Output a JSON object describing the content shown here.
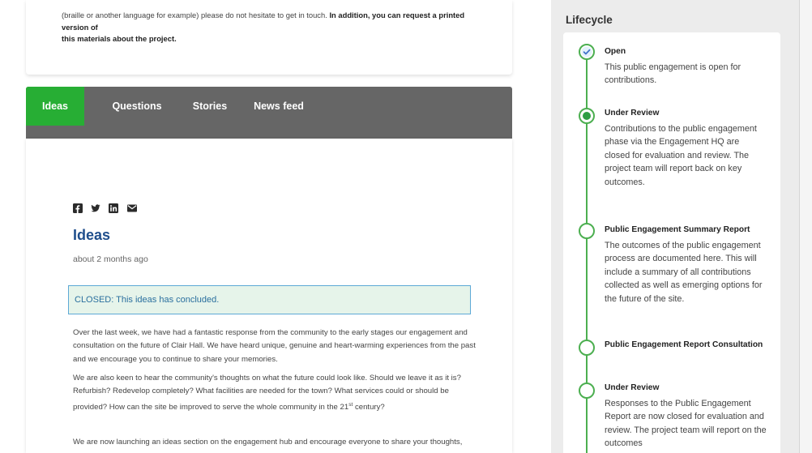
{
  "intro": {
    "line1_regular": "(braille or another language for example) please do not hesitate to get in touch.",
    "line1_bold": "In addition, you can request a printed version of",
    "line2_bold": "this materials about the project."
  },
  "tabs": [
    {
      "label": "Ideas",
      "active": true
    },
    {
      "label": "Questions",
      "active": false
    },
    {
      "label": "Stories",
      "active": false
    },
    {
      "label": "News feed",
      "active": false
    }
  ],
  "share": [
    {
      "icon": "facebook-icon"
    },
    {
      "icon": "twitter-icon"
    },
    {
      "icon": "linkedin-icon"
    },
    {
      "icon": "email-icon"
    }
  ],
  "content": {
    "title": "Ideas",
    "date": "about 2 months ago",
    "closed_notice": "CLOSED: This ideas has concluded.",
    "paragraph1": "Over the last week, we have had a fantastic response from the community to the early stages our engagement and consultation on the future of Clair Hall. We have heard unique, genuine and heart-warming experiences from the past and we encourage you to continue to share your memories.",
    "paragraph2_main": "We are also keen to hear the community's thoughts on what the future could look like. Should we leave it as it is? Refurbish? Redevelop completely? What facilities are needed for the town? What services could or should be provided? How can the site be improved to serve the whole community in the 21",
    "paragraph2_sup": "st",
    "paragraph2_end": " century?",
    "paragraph3": "We are now launching an ideas section on the engagement hub and encourage everyone to share your thoughts,"
  },
  "lifecycle": {
    "title": "Lifecycle",
    "stages": [
      {
        "name": "Open",
        "status": "done",
        "description": "This public engagement  is open for contributions."
      },
      {
        "name": "Under Review",
        "status": "current",
        "description": "Contributions to the public engagement phase via the Engagement HQ are closed for evaluation and review. The project team will report back on key outcomes."
      },
      {
        "name": "Public Engagement Summary Report",
        "status": "upcoming",
        "description": "The outcomes of the public engagement process are documented here. This will include a summary of all contributions collected as well as emerging options for the future of the site."
      },
      {
        "name": "Public Engagement Report Consultation",
        "status": "upcoming",
        "description": ""
      },
      {
        "name": "Under Review",
        "status": "upcoming",
        "description": "Responses to the Public Engagement Report are now closed for evaluation and review. The project team will report on the outcomes"
      }
    ]
  },
  "colors": {
    "tab_active": "#27ae34",
    "tab_bar": "#666666",
    "title_blue": "#1f4e8c",
    "timeline_green": "#4caf50"
  }
}
